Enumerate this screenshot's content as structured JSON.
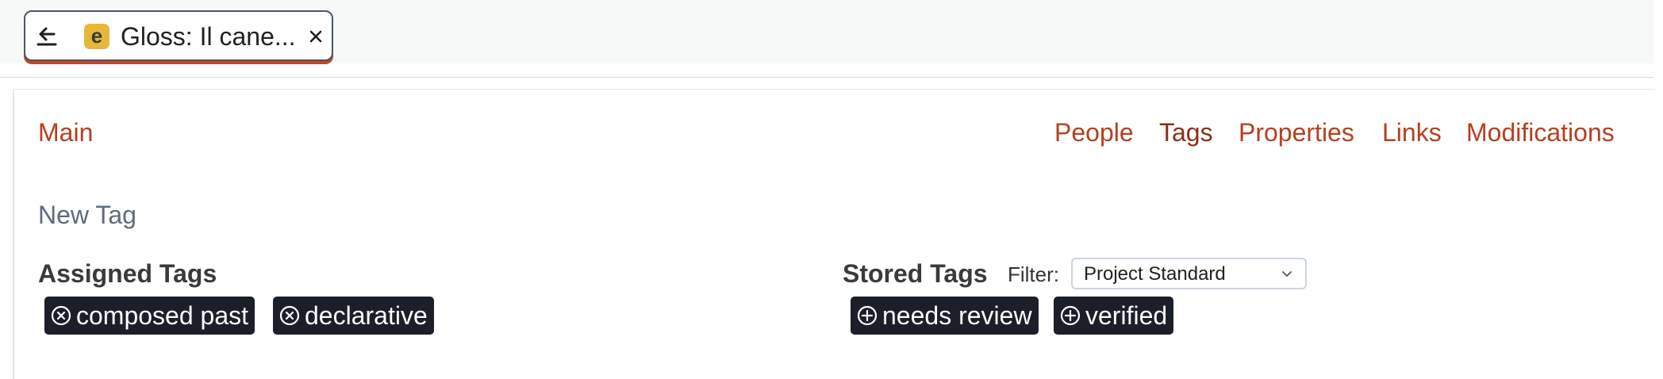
{
  "tab": {
    "badge": "e",
    "title": "Gloss: Il cane...",
    "back_icon": "arrow-left-icon",
    "close_icon": "close-icon"
  },
  "nav": {
    "main": "Main",
    "links": [
      "People",
      "Tags",
      "Properties",
      "Links",
      "Modifications"
    ],
    "active": "Tags"
  },
  "new_tag_label": "New Tag",
  "assigned": {
    "title": "Assigned Tags",
    "tags": [
      "composed past",
      "declarative"
    ],
    "chip_icon": "remove-circle-icon"
  },
  "stored": {
    "title": "Stored Tags",
    "filter_label": "Filter:",
    "filter_value": "Project Standard",
    "tags": [
      "needs review",
      "verified"
    ],
    "chip_icon": "add-circle-icon"
  },
  "colors": {
    "link": "#b5401f",
    "tab_underline": "#c2462a",
    "chip_bg": "#1c1f2a",
    "badge_bg": "#e6b83a"
  }
}
